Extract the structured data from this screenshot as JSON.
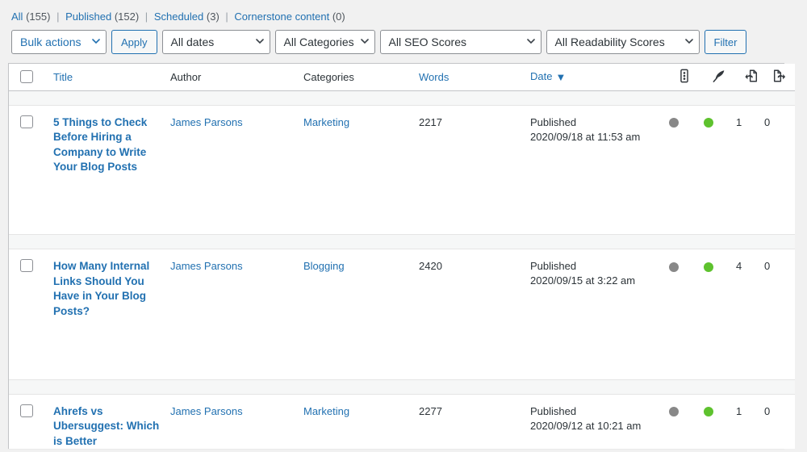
{
  "status_links": [
    {
      "label": "All",
      "count": "(155)",
      "active": true
    },
    {
      "label": "Published",
      "count": "(152)",
      "active": false
    },
    {
      "label": "Scheduled",
      "count": "(3)",
      "active": false
    },
    {
      "label": "Cornerstone content",
      "count": "(0)",
      "active": false
    }
  ],
  "separator": "|",
  "toolbar": {
    "bulk_actions_label": "Bulk actions",
    "apply_label": "Apply",
    "date_filter_label": "All dates",
    "category_filter_label": "All Categories",
    "seo_filter_label": "All SEO Scores",
    "readability_filter_label": "All Readability Scores",
    "filter_button_label": "Filter"
  },
  "table": {
    "columns": [
      {
        "key": "cb",
        "label": "",
        "icon": "select-all-checkbox",
        "sortable": false,
        "link": false
      },
      {
        "key": "title",
        "label": "Title",
        "icon": null,
        "sortable": true,
        "link": true
      },
      {
        "key": "author",
        "label": "Author",
        "icon": null,
        "sortable": false,
        "link": false
      },
      {
        "key": "cats",
        "label": "Categories",
        "icon": null,
        "sortable": false,
        "link": false
      },
      {
        "key": "words",
        "label": "Words",
        "icon": null,
        "sortable": true,
        "link": true
      },
      {
        "key": "date",
        "label": "Date",
        "icon": null,
        "sortable": true,
        "link": true,
        "sort_dir": "desc",
        "sort_caret": "▼"
      },
      {
        "key": "seo",
        "label": "",
        "icon": "seo-score-icon",
        "sortable": true,
        "link": false
      },
      {
        "key": "read",
        "label": "",
        "icon": "readability-quill-icon",
        "sortable": true,
        "link": false
      },
      {
        "key": "inlinks",
        "label": "",
        "icon": "incoming-links-icon",
        "sortable": true,
        "link": false
      },
      {
        "key": "outlinks",
        "label": "",
        "icon": "outgoing-links-icon",
        "sortable": true,
        "link": false
      }
    ],
    "rows": [
      {
        "title": "5 Things to Check Before Hiring a Company to Write Your Blog Posts",
        "author": "James Parsons",
        "categories": "Marketing",
        "words": "2217",
        "date_status": "Published",
        "date_value": "2020/09/18 at 11:53 am",
        "seo_score": "na",
        "readability_score": "good",
        "incoming_links": "1",
        "outgoing_links": "0"
      },
      {
        "title": "How Many Internal Links Should You Have in Your Blog Posts?",
        "author": "James Parsons",
        "categories": "Blogging",
        "words": "2420",
        "date_status": "Published",
        "date_value": "2020/09/15 at 3:22 am",
        "seo_score": "na",
        "readability_score": "good",
        "incoming_links": "4",
        "outgoing_links": "0"
      },
      {
        "title": "Ahrefs vs Ubersuggest: Which is Better",
        "author": "James Parsons",
        "categories": "Marketing",
        "words": "2277",
        "date_status": "Published",
        "date_value": "2020/09/12 at 10:21 am",
        "seo_score": "na",
        "readability_score": "good",
        "incoming_links": "1",
        "outgoing_links": "0"
      }
    ]
  },
  "colors": {
    "link": "#2271b1",
    "text": "#2c3338",
    "page_bg": "#f1f1f1",
    "table_bg": "#ffffff",
    "border": "#c3c4c7",
    "score_na": "#888888",
    "score_good": "#5ec22e"
  }
}
